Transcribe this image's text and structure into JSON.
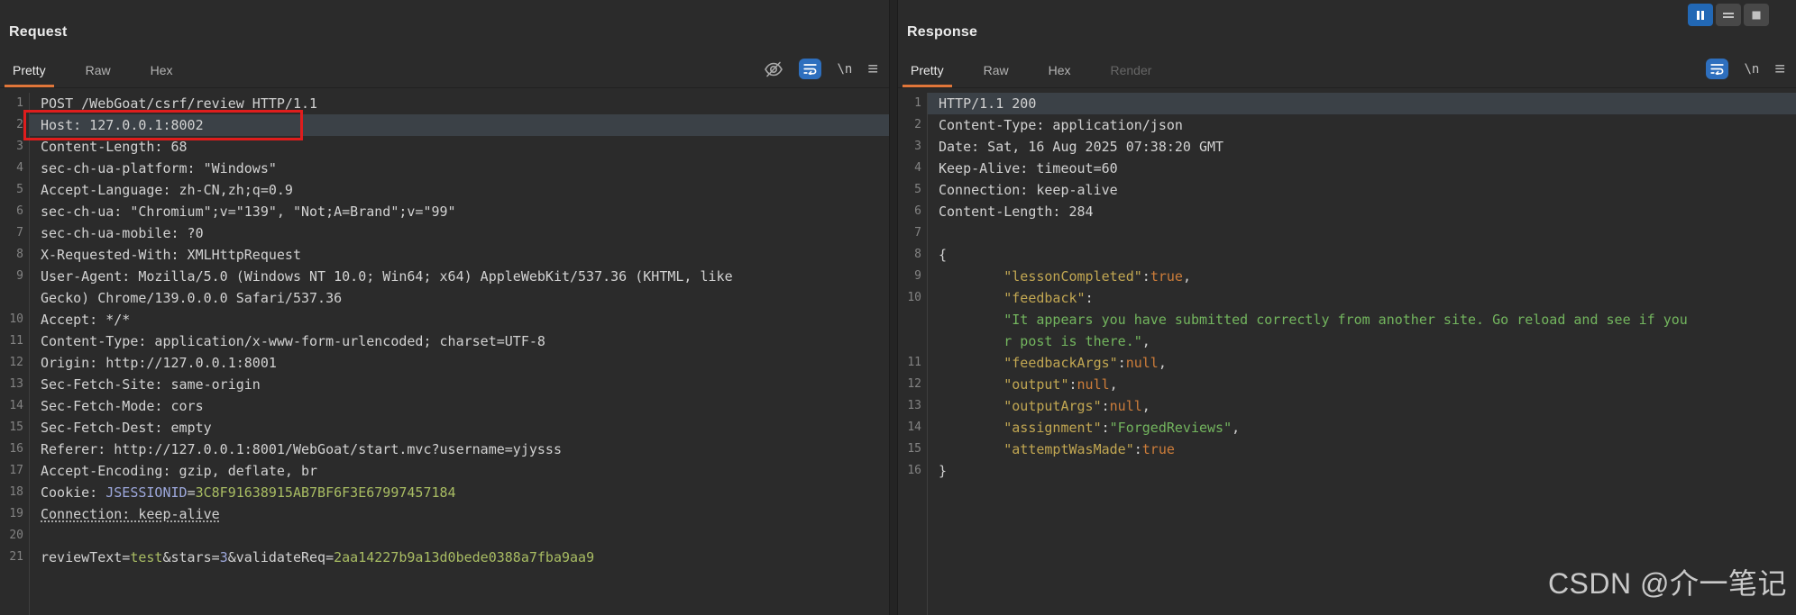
{
  "request": {
    "title": "Request",
    "tabs": [
      {
        "label": "Pretty"
      },
      {
        "label": "Raw"
      },
      {
        "label": "Hex"
      }
    ],
    "newline_label": "\\n",
    "lines": [
      {
        "n": "1",
        "segs": [
          {
            "t": "POST /WebGoat/csrf/review HTTP/1.1"
          }
        ]
      },
      {
        "n": "2",
        "hl": true,
        "segs": [
          {
            "t": "Host: 127.0.0.1:8002"
          }
        ]
      },
      {
        "n": "3",
        "segs": [
          {
            "t": "Content-Length: 68"
          }
        ]
      },
      {
        "n": "4",
        "segs": [
          {
            "t": "sec-ch-ua-platform: \"Windows\""
          }
        ]
      },
      {
        "n": "5",
        "segs": [
          {
            "t": "Accept-Language: zh-CN,zh;q=0.9"
          }
        ]
      },
      {
        "n": "6",
        "segs": [
          {
            "t": "sec-ch-ua: \"Chromium\";v=\"139\", \"Not;A=Brand\";v=\"99\""
          }
        ]
      },
      {
        "n": "7",
        "segs": [
          {
            "t": "sec-ch-ua-mobile: ?0"
          }
        ]
      },
      {
        "n": "8",
        "segs": [
          {
            "t": "X-Requested-With: XMLHttpRequest"
          }
        ]
      },
      {
        "n": "9",
        "segs": [
          {
            "t": "User-Agent: Mozilla/5.0 (Windows NT 10.0; Win64; x64) AppleWebKit/537.36 (KHTML, like"
          }
        ]
      },
      {
        "n": "",
        "segs": [
          {
            "t": "Gecko) Chrome/139.0.0.0 Safari/537.36"
          }
        ]
      },
      {
        "n": "10",
        "segs": [
          {
            "t": "Accept: */*"
          }
        ]
      },
      {
        "n": "11",
        "segs": [
          {
            "t": "Content-Type: application/x-www-form-urlencoded; charset=UTF-8"
          }
        ]
      },
      {
        "n": "12",
        "segs": [
          {
            "t": "Origin: http://127.0.0.1:8001"
          }
        ]
      },
      {
        "n": "13",
        "segs": [
          {
            "t": "Sec-Fetch-Site: same-origin"
          }
        ]
      },
      {
        "n": "14",
        "segs": [
          {
            "t": "Sec-Fetch-Mode: cors"
          }
        ]
      },
      {
        "n": "15",
        "segs": [
          {
            "t": "Sec-Fetch-Dest: empty"
          }
        ]
      },
      {
        "n": "16",
        "segs": [
          {
            "t": "Referer: http://127.0.0.1:8001/WebGoat/start.mvc?username=yjysss"
          }
        ]
      },
      {
        "n": "17",
        "segs": [
          {
            "t": "Accept-Encoding: gzip, deflate, br"
          }
        ]
      },
      {
        "n": "18",
        "segs": [
          {
            "t": "Cookie: "
          },
          {
            "t": "JSESSIONID",
            "c": "blue"
          },
          {
            "t": "="
          },
          {
            "t": "3C8F91638915AB7BF6F3E67997457184",
            "c": "green"
          }
        ]
      },
      {
        "n": "19",
        "segs": [
          {
            "t": "Connection: keep-alive",
            "u": true
          }
        ]
      },
      {
        "n": "20",
        "segs": []
      },
      {
        "n": "21",
        "segs": [
          {
            "t": "reviewText="
          },
          {
            "t": "test",
            "c": "green"
          },
          {
            "t": "&stars="
          },
          {
            "t": "3",
            "c": "blue"
          },
          {
            "t": "&validateReq="
          },
          {
            "t": "2aa14227b9a13d0bede0388a7fba9aa9",
            "c": "green"
          }
        ]
      }
    ]
  },
  "response": {
    "title": "Response",
    "tabs": [
      {
        "label": "Pretty"
      },
      {
        "label": "Raw"
      },
      {
        "label": "Hex"
      },
      {
        "label": "Render"
      }
    ],
    "newline_label": "\\n",
    "lines": [
      {
        "n": "1",
        "hl": true,
        "segs": [
          {
            "t": "HTTP/1.1 200"
          }
        ]
      },
      {
        "n": "2",
        "segs": [
          {
            "t": "Content-Type: application/json"
          }
        ]
      },
      {
        "n": "3",
        "segs": [
          {
            "t": "Date: Sat, 16 Aug 2025 07:38:20 GMT"
          }
        ]
      },
      {
        "n": "4",
        "segs": [
          {
            "t": "Keep-Alive: timeout=60"
          }
        ]
      },
      {
        "n": "5",
        "segs": [
          {
            "t": "Connection: keep-alive"
          }
        ]
      },
      {
        "n": "6",
        "segs": [
          {
            "t": "Content-Length: 284"
          }
        ]
      },
      {
        "n": "7",
        "segs": []
      },
      {
        "n": "8",
        "segs": [
          {
            "t": "{"
          }
        ]
      },
      {
        "n": "9",
        "segs": [
          {
            "t": "        "
          },
          {
            "t": "\"lessonCompleted\"",
            "c": "key"
          },
          {
            "t": ":"
          },
          {
            "t": "true",
            "c": "lit"
          },
          {
            "t": ","
          }
        ]
      },
      {
        "n": "10",
        "segs": [
          {
            "t": "        "
          },
          {
            "t": "\"feedback\"",
            "c": "key"
          },
          {
            "t": ":"
          }
        ]
      },
      {
        "n": "",
        "segs": [
          {
            "t": "        "
          },
          {
            "t": "\"It appears you have submitted correctly from another site. Go reload and see if you",
            "c": "str"
          }
        ]
      },
      {
        "n": "",
        "segs": [
          {
            "t": "        "
          },
          {
            "t": "r post is there.\"",
            "c": "str"
          },
          {
            "t": ","
          }
        ]
      },
      {
        "n": "11",
        "segs": [
          {
            "t": "        "
          },
          {
            "t": "\"feedbackArgs\"",
            "c": "key"
          },
          {
            "t": ":"
          },
          {
            "t": "null",
            "c": "lit"
          },
          {
            "t": ","
          }
        ]
      },
      {
        "n": "12",
        "segs": [
          {
            "t": "        "
          },
          {
            "t": "\"output\"",
            "c": "key"
          },
          {
            "t": ":"
          },
          {
            "t": "null",
            "c": "lit"
          },
          {
            "t": ","
          }
        ]
      },
      {
        "n": "13",
        "segs": [
          {
            "t": "        "
          },
          {
            "t": "\"outputArgs\"",
            "c": "key"
          },
          {
            "t": ":"
          },
          {
            "t": "null",
            "c": "lit"
          },
          {
            "t": ","
          }
        ]
      },
      {
        "n": "14",
        "segs": [
          {
            "t": "        "
          },
          {
            "t": "\"assignment\"",
            "c": "key"
          },
          {
            "t": ":"
          },
          {
            "t": "\"ForgedReviews\"",
            "c": "str"
          },
          {
            "t": ","
          }
        ]
      },
      {
        "n": "15",
        "segs": [
          {
            "t": "        "
          },
          {
            "t": "\"attemptWasMade\"",
            "c": "key"
          },
          {
            "t": ":"
          },
          {
            "t": "true",
            "c": "lit"
          }
        ]
      },
      {
        "n": "16",
        "segs": [
          {
            "t": "}"
          }
        ]
      }
    ]
  },
  "watermark": "CSDN @介一笔记",
  "colors": {
    "accent_orange": "#e0763a",
    "button_blue": "#2268b5",
    "annotation_red": "#df1d1d",
    "value_green": "#a9bd63",
    "cookie_name_blue": "#9da8dc",
    "json_key": "#c2a752",
    "json_string": "#73b55e",
    "json_literal": "#cd7d3a",
    "row_highlight": "#3b4147",
    "background": "#2b2b2b"
  }
}
